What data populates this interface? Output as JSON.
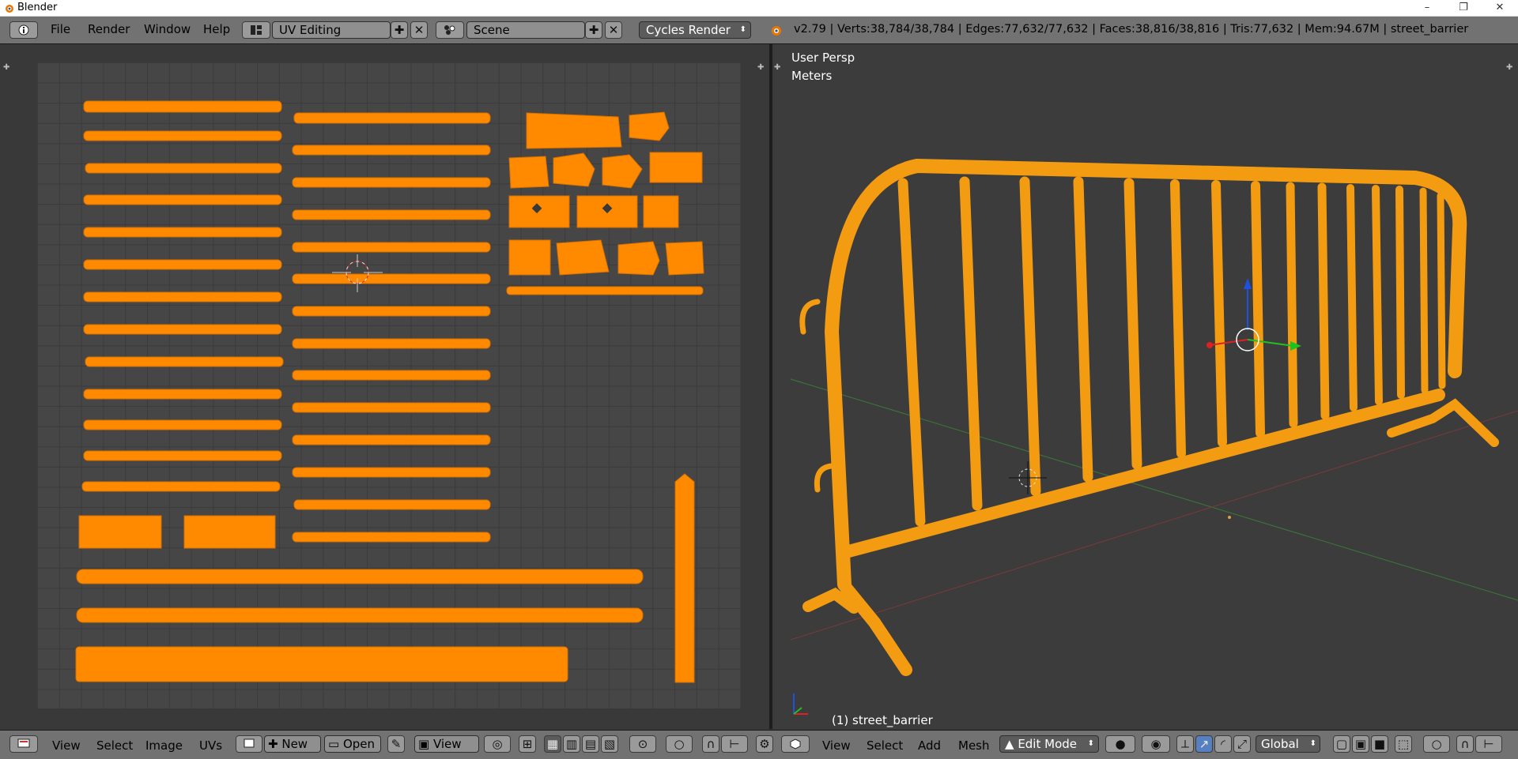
{
  "window": {
    "title": "Blender",
    "minimize": "–",
    "maximize": "❐",
    "close": "✕"
  },
  "topbar": {
    "menus": [
      "File",
      "Render",
      "Window",
      "Help"
    ],
    "screen_layout": "UV Editing",
    "scene": "Scene",
    "render_engine": "Cycles Render",
    "stats": "v2.79 | Verts:38,784/38,784 | Edges:77,632/77,632 | Faces:38,816/38,816 | Tris:77,632 | Mem:94.67M | street_barrier"
  },
  "uv_editor": {
    "bottom_menus": [
      "View",
      "Select",
      "Image",
      "UVs"
    ],
    "new_label": "New",
    "open_label": "Open",
    "view_label": "View"
  },
  "viewport": {
    "view_name": "User Persp",
    "units": "Meters",
    "object_label": "(1) street_barrier",
    "bottom_menus": [
      "View",
      "Select",
      "Add",
      "Mesh"
    ],
    "mode": "Edit Mode",
    "orientation": "Global"
  },
  "colors": {
    "accent_orange": "#ff8a00",
    "barrier_orange": "#f39c12",
    "header_gray": "#727272",
    "axis_x": "#e02020",
    "axis_y": "#20c020",
    "axis_z": "#2050e0"
  },
  "icons": [
    "blender-logo-icon",
    "info-icon",
    "screen-layout-icon",
    "scene-icon",
    "plus-icon",
    "close-icon",
    "cursor-icon",
    "axis-gizmo-icon"
  ]
}
